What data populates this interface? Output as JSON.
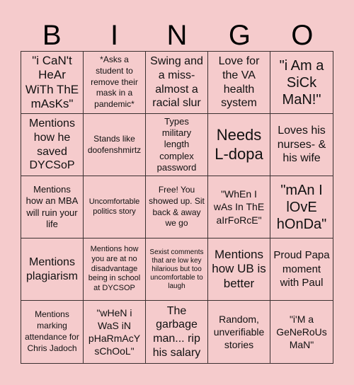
{
  "header": {
    "letters": [
      "B",
      "I",
      "N",
      "G",
      "O"
    ]
  },
  "board": {
    "background_color": "#f5cbcc",
    "border_color": "#3a3030",
    "rows": [
      [
        "\"i CaN't HeAr WiTh ThE mAsKs\"",
        "*Asks a student to remove their mask in a pandemic*",
        "Swing and a miss- almost a racial slur",
        "Love for the VA health system",
        "\"i Am a SiCk MaN!\""
      ],
      [
        "Mentions how he saved DYCSoP",
        "Stands like doofenshmirtz",
        "Types military length complex password",
        "Needs L-dopa",
        "Loves his nurses- & his wife"
      ],
      [
        "Mentions how an MBA will ruin your life",
        "Uncomfortable politics story",
        "Free! You showed up. Sit back & away we go",
        "\"WhEn I wAs In ThE aIrFoRcE\"",
        "\"mAn I lOvE hOnDa\""
      ],
      [
        "Mentions plagiarism",
        "Mentions how you are at no disadvantage being in school at DYCSOP",
        "Sexist comments that are low key hilarious but too uncomfortable to laugh",
        "Mentions how UB is better",
        "Proud Papa moment with Paul"
      ],
      [
        "Mentions marking attendance for Chris Jadoch",
        "\"wHeN i WaS iN pHaRmAcY sChOoL\"",
        "The garbage man... rip his salary",
        "Random, unverifiable stories",
        "\"i'M a GeNeRoUs MaN\""
      ]
    ]
  }
}
